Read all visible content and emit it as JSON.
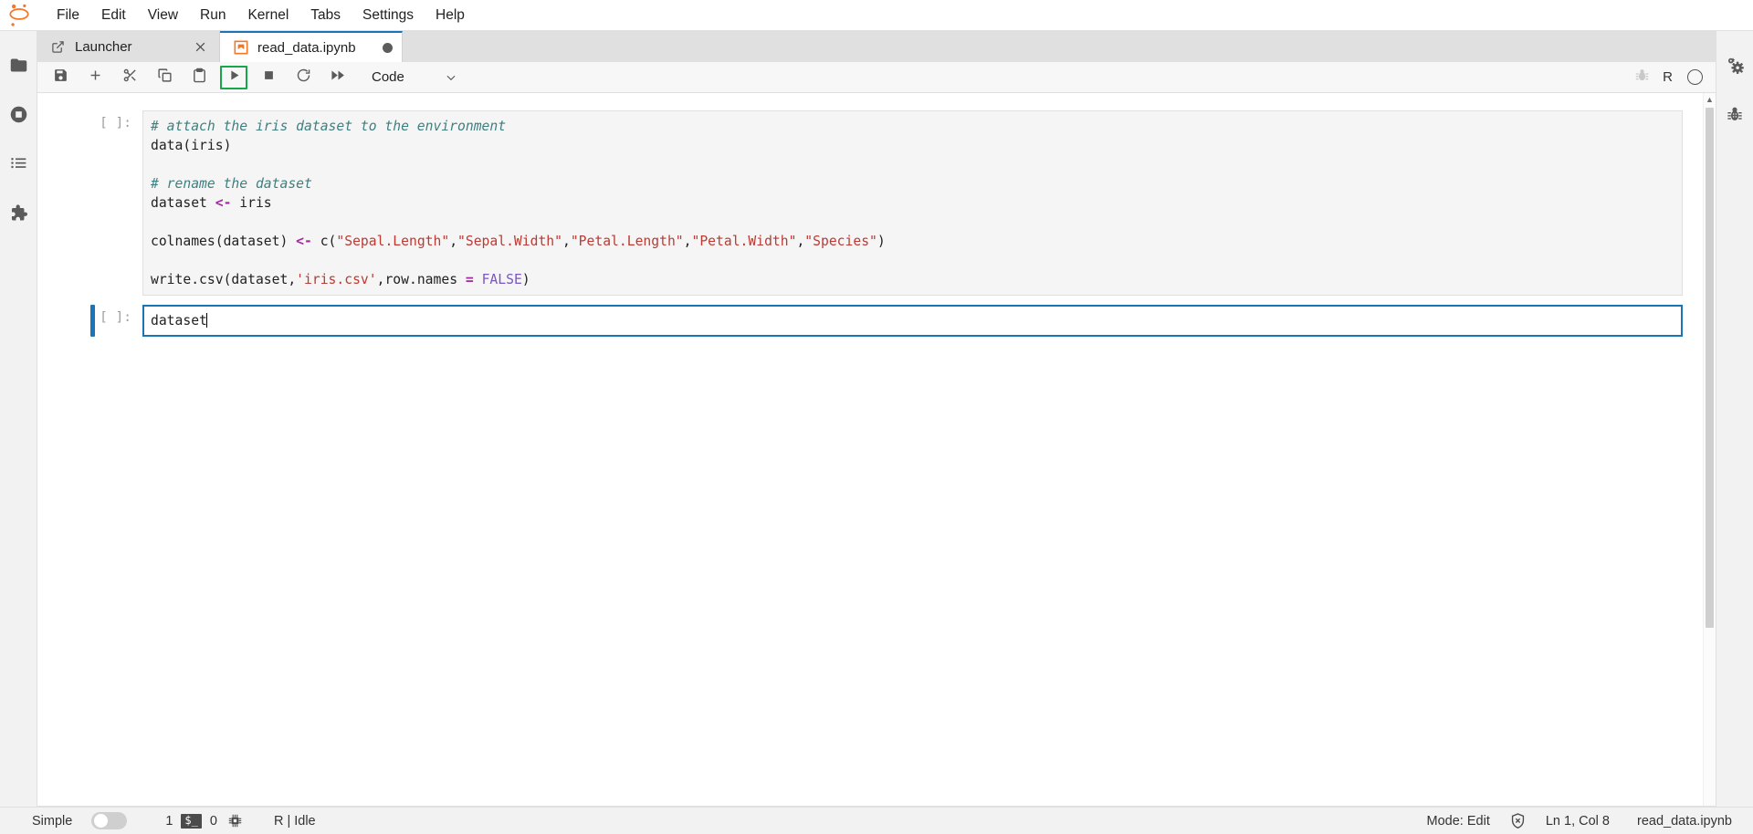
{
  "app": {
    "logo": "jupyter-logo",
    "title": "JupyterLab"
  },
  "menubar": {
    "items": [
      {
        "label": "File",
        "name": "menu-file"
      },
      {
        "label": "Edit",
        "name": "menu-edit"
      },
      {
        "label": "View",
        "name": "menu-view"
      },
      {
        "label": "Run",
        "name": "menu-run"
      },
      {
        "label": "Kernel",
        "name": "menu-kernel"
      },
      {
        "label": "Tabs",
        "name": "menu-tabs"
      },
      {
        "label": "Settings",
        "name": "menu-settings"
      },
      {
        "label": "Help",
        "name": "menu-help"
      }
    ]
  },
  "left_sidebar": {
    "items": [
      {
        "icon": "folder-icon",
        "name": "sidebar-file-browser",
        "title": "File Browser"
      },
      {
        "icon": "running-terminals-icon",
        "name": "sidebar-running-terminals",
        "title": "Running Terminals and Kernels"
      },
      {
        "icon": "table-of-contents-icon",
        "name": "sidebar-table-of-contents",
        "title": "Table of Contents"
      },
      {
        "icon": "extension-puzzle-icon",
        "name": "sidebar-extension-manager",
        "title": "Extension Manager"
      }
    ]
  },
  "right_sidebar": {
    "items": [
      {
        "icon": "gears-icon",
        "name": "sidebar-property-inspector",
        "title": "Property Inspector"
      },
      {
        "icon": "bug-icon",
        "name": "sidebar-debugger",
        "title": "Debugger"
      }
    ]
  },
  "tabs": [
    {
      "label": "Launcher",
      "icon": "launcher-icon",
      "current": false,
      "closable": true,
      "dirty": false
    },
    {
      "label": "read_data.ipynb",
      "icon": "notebook-icon",
      "current": true,
      "closable": false,
      "dirty": true
    }
  ],
  "toolbar": {
    "buttons": [
      {
        "icon": "save-icon",
        "name": "save-button",
        "title": "Save and create checkpoint",
        "highlighted": false
      },
      {
        "icon": "plus-icon",
        "name": "insert-cell-button",
        "title": "Insert a cell below",
        "highlighted": false
      },
      {
        "icon": "scissors-icon",
        "name": "cut-cells-button",
        "title": "Cut this cell",
        "highlighted": false
      },
      {
        "icon": "copy-icon",
        "name": "copy-cells-button",
        "title": "Copy this cell",
        "highlighted": false
      },
      {
        "icon": "paste-icon",
        "name": "paste-cells-button",
        "title": "Paste this cell from the clipboard",
        "highlighted": false
      },
      {
        "icon": "run-icon",
        "name": "run-cell-button",
        "title": "Run the selected cells and advance",
        "highlighted": true
      },
      {
        "icon": "stop-icon",
        "name": "interrupt-kernel-button",
        "title": "Interrupt the kernel",
        "highlighted": false
      },
      {
        "icon": "restart-icon",
        "name": "restart-kernel-button",
        "title": "Restart the kernel",
        "highlighted": false
      },
      {
        "icon": "fast-forward-icon",
        "name": "restart-run-all-button",
        "title": "Restart the kernel and run all cells",
        "highlighted": false
      }
    ],
    "cell_type": "Code",
    "debug_icon": "bug-icon",
    "kernel_name": "R",
    "kernel_status_icon": "kernel-idle-circle"
  },
  "notebook": {
    "cells": [
      {
        "name": "code-cell-1",
        "prompt": "[ ]:",
        "selected": false,
        "lines": [
          [
            {
              "t": "# attach the iris dataset to the environment",
              "c": "comment"
            }
          ],
          [
            {
              "t": "data(iris)",
              "c": "plain"
            }
          ],
          [
            {
              "t": "",
              "c": "plain"
            }
          ],
          [
            {
              "t": "# rename the dataset",
              "c": "comment"
            }
          ],
          [
            {
              "t": "dataset ",
              "c": "plain"
            },
            {
              "t": "<-",
              "c": "op"
            },
            {
              "t": " iris",
              "c": "plain"
            }
          ],
          [
            {
              "t": "",
              "c": "plain"
            }
          ],
          [
            {
              "t": "colnames(dataset) ",
              "c": "plain"
            },
            {
              "t": "<-",
              "c": "op"
            },
            {
              "t": " c(",
              "c": "plain"
            },
            {
              "t": "\"Sepal.Length\"",
              "c": "string"
            },
            {
              "t": ",",
              "c": "plain"
            },
            {
              "t": "\"Sepal.Width\"",
              "c": "string"
            },
            {
              "t": ",",
              "c": "plain"
            },
            {
              "t": "\"Petal.Length\"",
              "c": "string"
            },
            {
              "t": ",",
              "c": "plain"
            },
            {
              "t": "\"Petal.Width\"",
              "c": "string"
            },
            {
              "t": ",",
              "c": "plain"
            },
            {
              "t": "\"Species\"",
              "c": "string"
            },
            {
              "t": ")",
              "c": "plain"
            }
          ],
          [
            {
              "t": "",
              "c": "plain"
            }
          ],
          [
            {
              "t": "write.csv(dataset,",
              "c": "plain"
            },
            {
              "t": "'iris.csv'",
              "c": "string"
            },
            {
              "t": ",row.names ",
              "c": "plain"
            },
            {
              "t": "=",
              "c": "op"
            },
            {
              "t": " ",
              "c": "plain"
            },
            {
              "t": "FALSE",
              "c": "const"
            },
            {
              "t": ")",
              "c": "plain"
            }
          ]
        ]
      },
      {
        "name": "code-cell-2",
        "prompt": "[ ]:",
        "selected": true,
        "cursor": true,
        "lines": [
          [
            {
              "t": "dataset",
              "c": "plain"
            }
          ]
        ]
      }
    ]
  },
  "statusbar": {
    "simple_label": "Simple",
    "simple_enabled": false,
    "kernel_count": "1",
    "terminal_icon": "terminal-icon",
    "terminal_count": "0",
    "kernel_icon": "cpu-chip-icon",
    "kernel_status": "R | Idle",
    "mode": "Mode: Edit",
    "trust_icon": "shield-x-icon",
    "cursor_position": "Ln 1, Col 8",
    "filename": "read_data.ipynb"
  },
  "colors": {
    "accent": "#1a74b8",
    "highlight_box": "#17a74a",
    "jupyter_orange": "#f37726",
    "chrome": "#f2f2f2",
    "editor_bg": "#f5f5f5"
  }
}
